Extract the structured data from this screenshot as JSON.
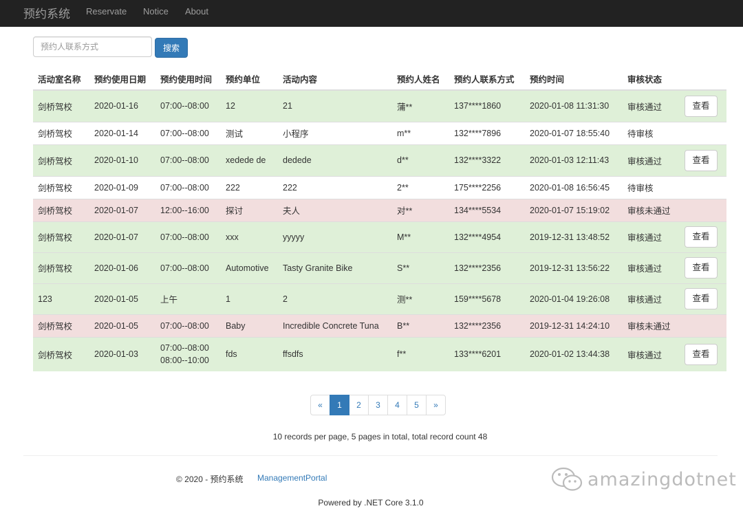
{
  "nav": {
    "brand": "预约系统",
    "links": [
      "Reservate",
      "Notice",
      "About"
    ]
  },
  "search": {
    "placeholder": "预约人联系方式",
    "button": "搜索"
  },
  "table": {
    "headers": [
      "活动室名称",
      "预约使用日期",
      "预约使用时间",
      "预约单位",
      "活动内容",
      "预约人姓名",
      "预约人联系方式",
      "预约时间",
      "审核状态",
      ""
    ],
    "rows": [
      {
        "status_class": "success",
        "room": "剑桥驾校",
        "date": "2020-01-16",
        "time": "07:00--08:00",
        "unit": "12",
        "content": "21",
        "name": "蒲**",
        "phone": "137****1860",
        "created": "2020-01-08 11:31:30",
        "status": "审核通过",
        "action": "查看"
      },
      {
        "status_class": "plain",
        "room": "剑桥驾校",
        "date": "2020-01-14",
        "time": "07:00--08:00",
        "unit": "测试",
        "content": "小程序",
        "name": "m**",
        "phone": "132****7896",
        "created": "2020-01-07 18:55:40",
        "status": "待审核",
        "action": ""
      },
      {
        "status_class": "success",
        "room": "剑桥驾校",
        "date": "2020-01-10",
        "time": "07:00--08:00",
        "unit": "xedede de",
        "content": "dedede",
        "name": "d**",
        "phone": "132****3322",
        "created": "2020-01-03 12:11:43",
        "status": "审核通过",
        "action": "查看"
      },
      {
        "status_class": "plain",
        "room": "剑桥驾校",
        "date": "2020-01-09",
        "time": "07:00--08:00",
        "unit": "222",
        "content": "222",
        "name": "2**",
        "phone": "175****2256",
        "created": "2020-01-08 16:56:45",
        "status": "待审核",
        "action": ""
      },
      {
        "status_class": "danger",
        "room": "剑桥驾校",
        "date": "2020-01-07",
        "time": "12:00--16:00",
        "unit": "探讨",
        "content": "夫人",
        "name": "对**",
        "phone": "134****5534",
        "created": "2020-01-07 15:19:02",
        "status": "审核未通过",
        "action": ""
      },
      {
        "status_class": "success",
        "room": "剑桥驾校",
        "date": "2020-01-07",
        "time": "07:00--08:00",
        "unit": "xxx",
        "content": "yyyyy",
        "name": "M**",
        "phone": "132****4954",
        "created": "2019-12-31 13:48:52",
        "status": "审核通过",
        "action": "查看"
      },
      {
        "status_class": "success",
        "room": "剑桥驾校",
        "date": "2020-01-06",
        "time": "07:00--08:00",
        "unit": "Automotive",
        "content": "Tasty Granite Bike",
        "name": "S**",
        "phone": "132****2356",
        "created": "2019-12-31 13:56:22",
        "status": "审核通过",
        "action": "查看"
      },
      {
        "status_class": "success",
        "room": "123",
        "date": "2020-01-05",
        "time": "上午",
        "unit": "1",
        "content": "2",
        "name": "测**",
        "phone": "159****5678",
        "created": "2020-01-04 19:26:08",
        "status": "审核通过",
        "action": "查看"
      },
      {
        "status_class": "danger",
        "room": "剑桥驾校",
        "date": "2020-01-05",
        "time": "07:00--08:00",
        "unit": "Baby",
        "content": "Incredible Concrete Tuna",
        "name": "B**",
        "phone": "132****2356",
        "created": "2019-12-31 14:24:10",
        "status": "审核未通过",
        "action": ""
      },
      {
        "status_class": "success",
        "room": "剑桥驾校",
        "date": "2020-01-03",
        "time": "07:00--08:00\n08:00--10:00",
        "unit": "fds",
        "content": "ffsdfs",
        "name": "f**",
        "phone": "133****6201",
        "created": "2020-01-02 13:44:38",
        "status": "审核通过",
        "action": "查看"
      }
    ]
  },
  "pagination": {
    "prev": "«",
    "pages": [
      "1",
      "2",
      "3",
      "4",
      "5"
    ],
    "active": "1",
    "next": "»"
  },
  "records_info": "10 records per page, 5 pages in total, total record count 48",
  "footer": {
    "copyright": "© 2020 - 预约系统",
    "portal_link": "ManagementPortal",
    "powered": "Powered by .NET Core 3.1.0"
  },
  "watermark": {
    "text": "amazingdotnet",
    "icon": "wechat-icon"
  },
  "colors": {
    "navbar": "#222222",
    "primary": "#337ab7",
    "row_success": "#dff0d8",
    "row_danger": "#f2dede"
  }
}
